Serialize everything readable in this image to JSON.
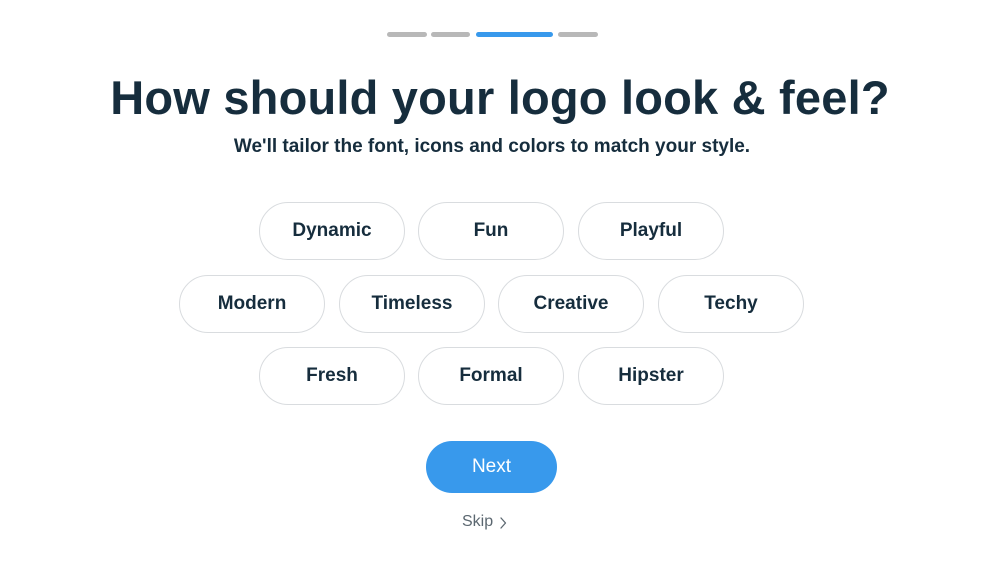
{
  "progress": {
    "steps": 4,
    "current_step": 3
  },
  "header": {
    "title": "How should your logo look & feel?",
    "subtitle": "We'll tailor the font, icons and colors to match your style."
  },
  "options": [
    "Dynamic",
    "Fun",
    "Playful",
    "Modern",
    "Timeless",
    "Creative",
    "Techy",
    "Fresh",
    "Formal",
    "Hipster"
  ],
  "actions": {
    "next_label": "Next",
    "skip_label": "Skip",
    "skip_icon": "chevron-right-icon"
  },
  "colors": {
    "accent": "#3899ec",
    "text": "#162d3d",
    "chip_border": "#d9dcdf",
    "progress_inactive": "#b8b8b8"
  }
}
